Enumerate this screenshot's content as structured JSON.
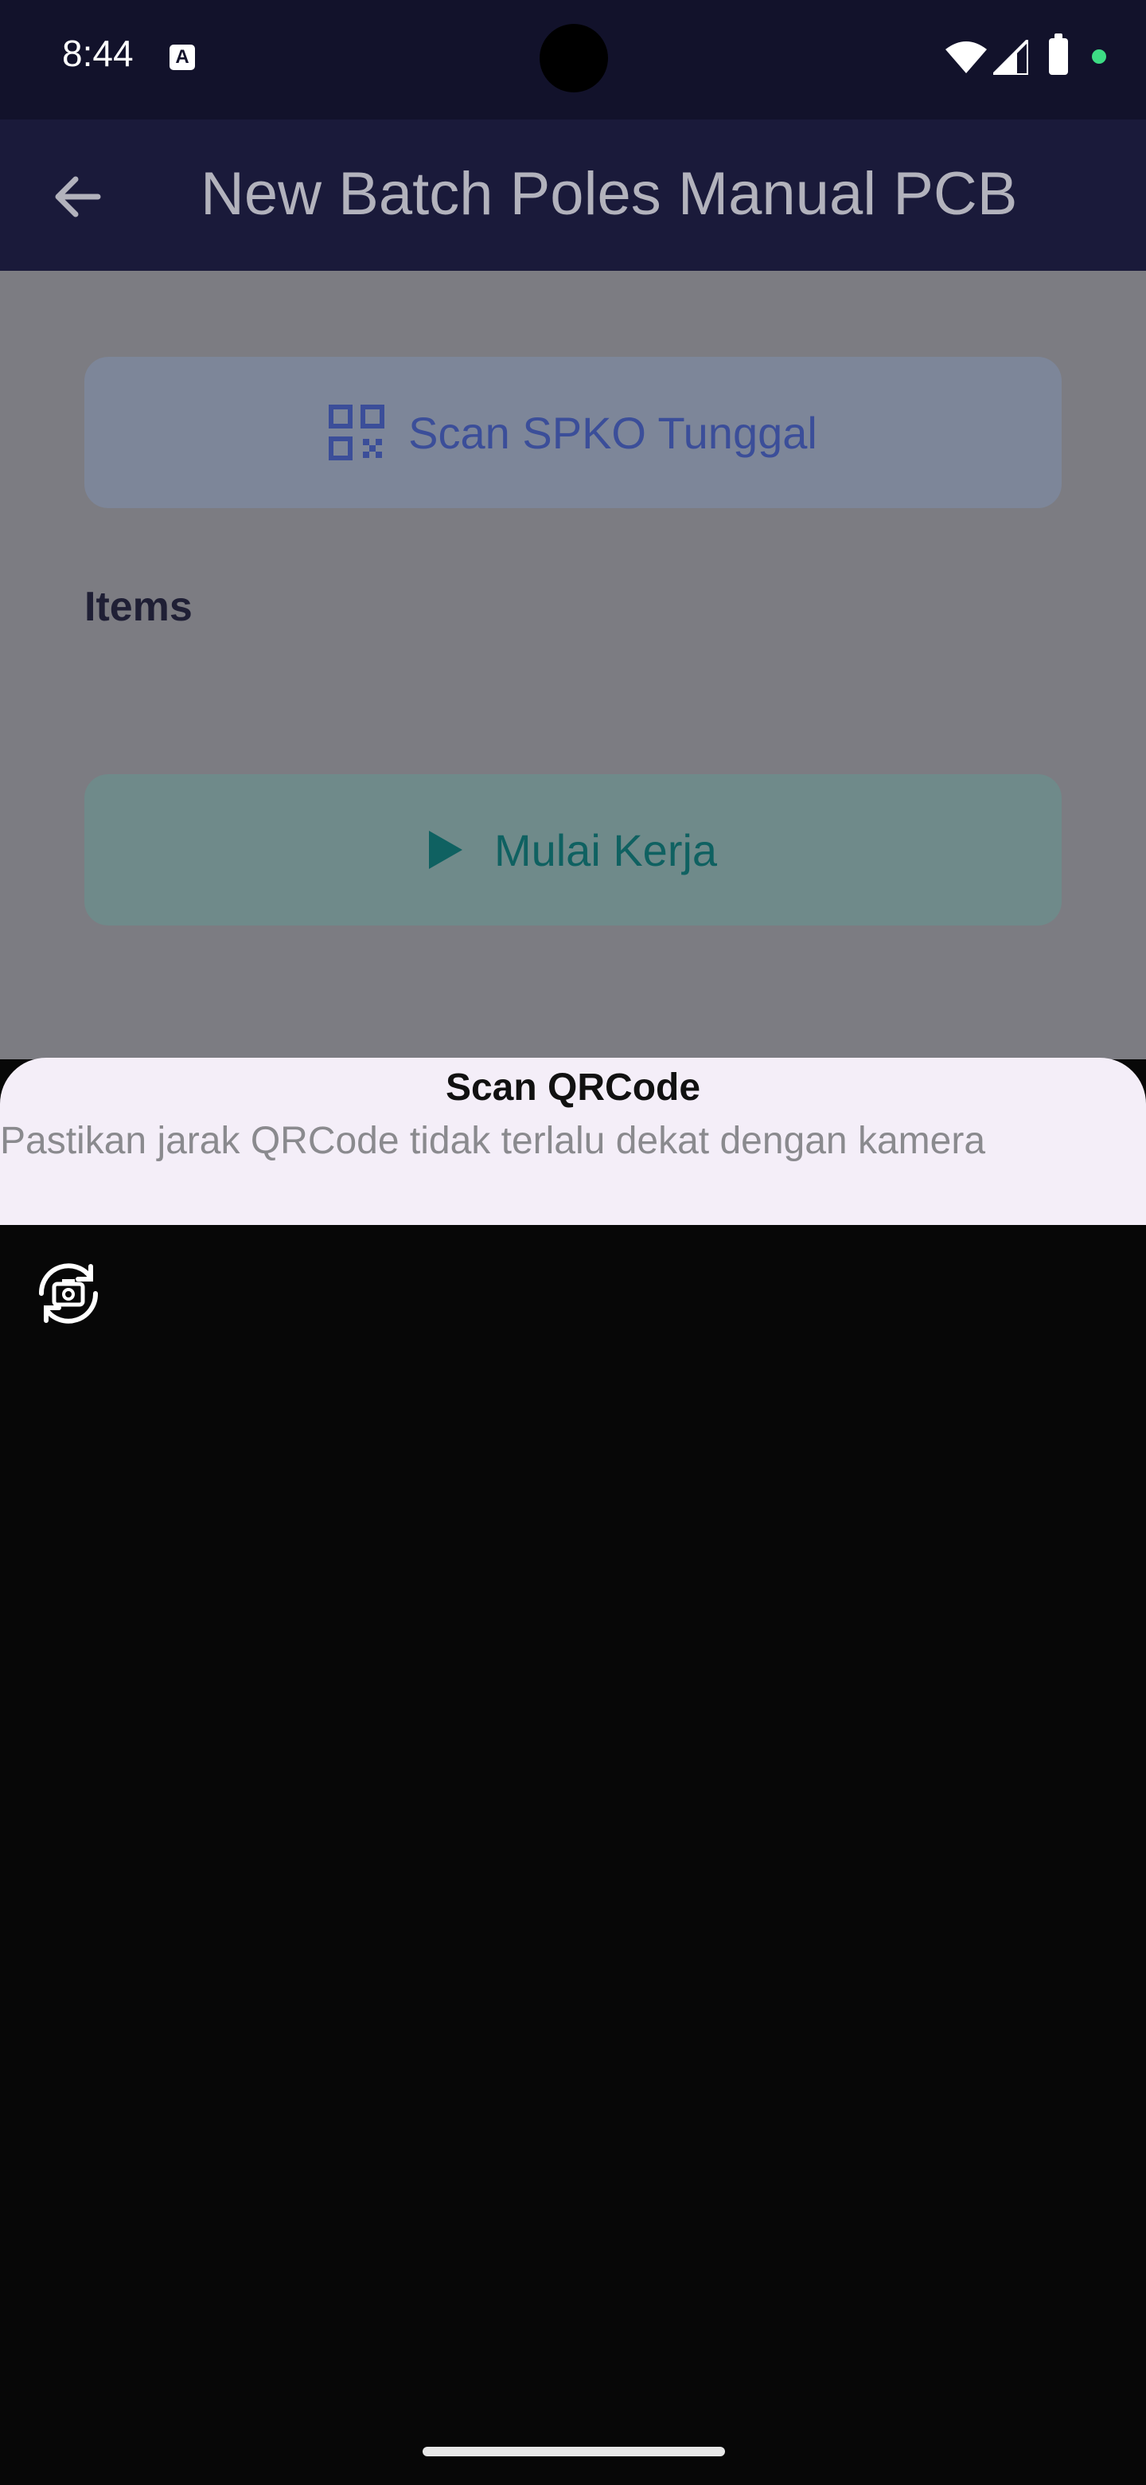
{
  "status_bar": {
    "time": "8:44",
    "icons": [
      "accessibility-a-icon",
      "wifi-icon",
      "signal-icon",
      "battery-icon",
      "green-dot-indicator"
    ]
  },
  "app_bar": {
    "title": "New Batch Poles Manual PCB",
    "back_icon": "arrow-left-icon"
  },
  "main": {
    "scan_button_label": "Scan SPKO Tunggal",
    "items_label": "Items",
    "start_button_label": "Mulai Kerja"
  },
  "sheet": {
    "title": "Scan QRCode",
    "description": "Pastikan jarak QRCode tidak terlalu dekat dengan kamera",
    "flip_icon": "camera-flip-icon"
  },
  "colors": {
    "appbar_bg": "#1a1a3a",
    "scan_text": "#3b4e99",
    "start_text": "#0f6161",
    "sheet_bg": "#f4eef8"
  }
}
